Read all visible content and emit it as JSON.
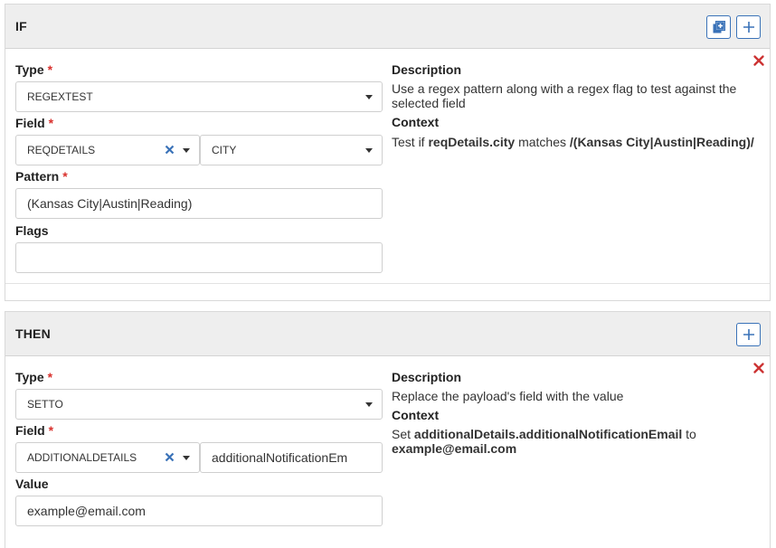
{
  "if_section": {
    "title": "IF",
    "type_label": "Type",
    "type_value": "REGEXTEST",
    "field_label": "Field",
    "field_value": "REQDETAILS",
    "subfield_value": "CITY",
    "pattern_label": "Pattern",
    "pattern_value": "(Kansas City|Austin|Reading)",
    "flags_label": "Flags",
    "flags_value": "",
    "description_title": "Description",
    "description_text": "Use a regex pattern along with a regex flag to test against the selected field",
    "context_title": "Context",
    "context_prefix": "Test if ",
    "context_field": "reqDetails.city",
    "context_middle": " matches ",
    "context_pattern": "/(Kansas City|Austin|Reading)/"
  },
  "then_section": {
    "title": "THEN",
    "type_label": "Type",
    "type_value": "SETTO",
    "field_label": "Field",
    "field_value": "ADDITIONALDETAILS",
    "subfield_value": "additionalNotificationEm",
    "value_label": "Value",
    "value_value": "example@email.com",
    "description_title": "Description",
    "description_text": "Replace the payload's field with the value",
    "context_title": "Context",
    "context_prefix": "Set ",
    "context_field": "additionalDetails.additionalNotificationEmail",
    "context_middle": " to",
    "context_value": "example@email.com"
  },
  "required_marker": "*",
  "colors": {
    "accent": "#3a72b8",
    "required": "#d9302c",
    "header_bg": "#eeeeee",
    "close": "#cc3333"
  },
  "icons": {
    "duplicate": "copy-plus-icon",
    "add": "plus-icon",
    "remove": "close-icon",
    "clear": "clear-x-icon",
    "dropdown": "chevron-down-icon"
  }
}
